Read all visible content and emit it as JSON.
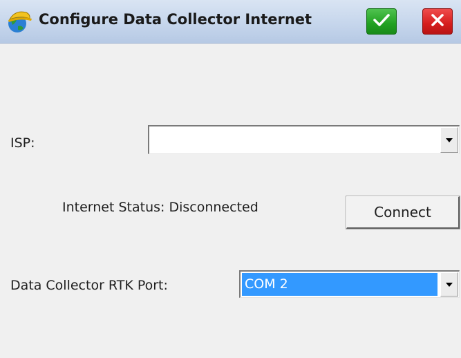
{
  "window": {
    "title": "Configure Data Collector Internet",
    "app_icon": "surveyor-hardhat-globe-icon",
    "ok_icon": "checkmark-icon",
    "cancel_icon": "close-x-icon"
  },
  "form": {
    "isp_label": "ISP:",
    "isp_value": "",
    "internet_status": "Internet Status: Disconnected",
    "connect_label": "Connect",
    "rtk_port_label": "Data Collector RTK Port:",
    "rtk_port_value": "COM 2"
  },
  "colors": {
    "ok_green": "#21a121",
    "cancel_red": "#d61d1d",
    "selection_blue": "#3399ff",
    "titlebar": "#c6d6ec"
  }
}
